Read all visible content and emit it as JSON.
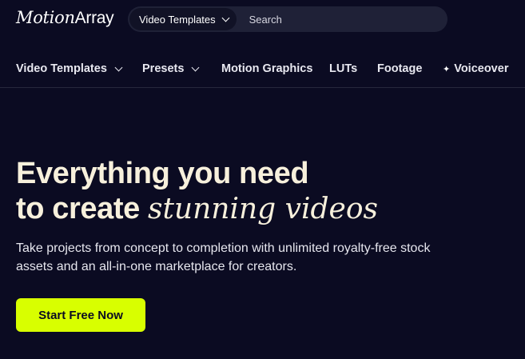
{
  "logo": {
    "part1": "Motion",
    "part2": "Array"
  },
  "search": {
    "category": "Video Templates",
    "placeholder": "Search"
  },
  "nav": {
    "items": [
      {
        "label": "Video Templates",
        "dropdown": true
      },
      {
        "label": "Presets",
        "dropdown": true
      },
      {
        "label": "Motion Graphics"
      },
      {
        "label": "LUTs"
      },
      {
        "label": "Footage"
      },
      {
        "label": "Voiceover",
        "icon": "sparkle-icon"
      }
    ]
  },
  "hero": {
    "line1": "Everything you need",
    "line2_plain": "to create ",
    "line2_accent": "stunning videos",
    "subtext": "Take projects from concept to completion with unlimited royalty-free stock assets and an all-in-one marketplace for creators.",
    "cta_label": "Start Free Now"
  },
  "colors": {
    "background": "#0b0b22",
    "cta": "#d8ff00",
    "headline": "#f7f0dc"
  }
}
